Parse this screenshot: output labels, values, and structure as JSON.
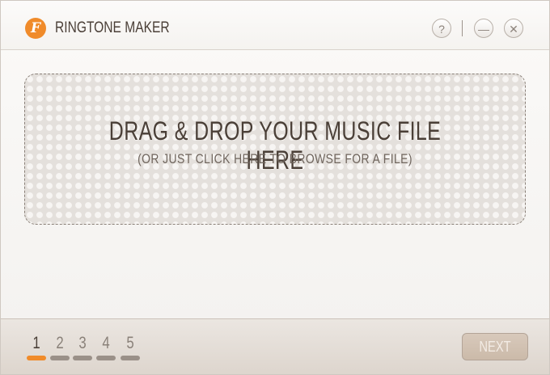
{
  "app": {
    "title": "RINGTONE MAKER",
    "logo_letter": "F",
    "accent_color": "#f08b2a"
  },
  "window_controls": {
    "help_label": "?",
    "minimize_label": "—",
    "close_label": "✕"
  },
  "dropzone": {
    "title": "DRAG & DROP YOUR MUSIC FILE HERE",
    "subtitle": "(OR JUST CLICK HERE TO BROWSE FOR A FILE)"
  },
  "steps": {
    "current": 1,
    "items": [
      {
        "label": "1"
      },
      {
        "label": "2"
      },
      {
        "label": "3"
      },
      {
        "label": "4"
      },
      {
        "label": "5"
      }
    ]
  },
  "footer": {
    "next_label": "NEXT"
  }
}
